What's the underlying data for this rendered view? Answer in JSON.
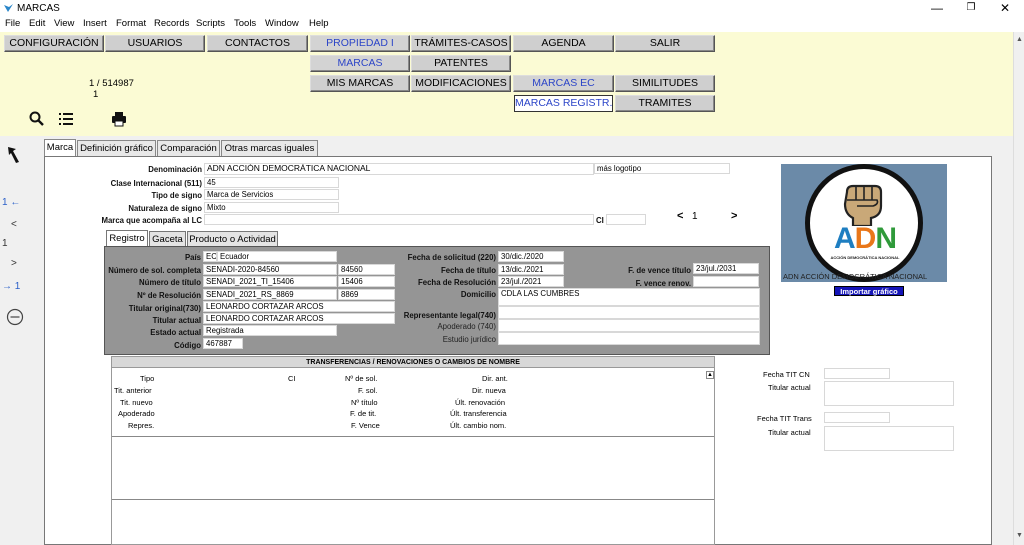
{
  "window": {
    "title": "MARCAS",
    "min": "—",
    "max": "❐",
    "close": "✕"
  },
  "menu": [
    "File",
    "Edit",
    "View",
    "Insert",
    "Format",
    "Records",
    "Scripts",
    "Tools",
    "Window",
    "Help"
  ],
  "nav": {
    "row1": [
      "CONFIGURACIÓN",
      "USUARIOS",
      "CONTACTOS",
      "PROPIEDAD I",
      "TRÁMITES-CASOS",
      "AGENDA",
      "SALIR"
    ],
    "row2": [
      "MARCAS",
      "PATENTES"
    ],
    "row3": [
      "MIS MARCAS",
      "MODIFICACIONES",
      "MARCAS EC",
      "SIMILITUDES"
    ],
    "row4": [
      "MARCAS REGISTR.",
      "TRAMITES"
    ]
  },
  "records": {
    "position": "1 / 514987",
    "found": "1"
  },
  "icons": {
    "search": "search-icon",
    "list": "list-icon",
    "print": "print-icon",
    "back": "back-arrow-icon",
    "remove": "minus-circle-icon"
  },
  "left_panel": {
    "prev_link": "1 ←",
    "prev": "<",
    "page": "1",
    "next": ">",
    "next_link": "→ 1"
  },
  "tabs": [
    "Marca",
    "Definición gráfico",
    "Comparación",
    "Otras marcas iguales"
  ],
  "marca": {
    "denominacion_label": "Denominación",
    "denominacion": "ADN ACCIÓN DEMOCRÁTICA NACIONAL",
    "extra": "más logotipo",
    "clase_label": "Clase Internacional (511)",
    "clase": "45",
    "tipo_label": "Tipo de signo",
    "tipo": "Marca de Servicios",
    "naturaleza_label": "Naturaleza de signo",
    "naturaleza": "Mixto",
    "acompana_label": "Marca que acompaña al LC",
    "ci_label": "CI",
    "pager_prev": "<",
    "pager_page": "1",
    "pager_next": ">"
  },
  "subtabs": [
    "Registro",
    "Gaceta",
    "Producto o Actividad"
  ],
  "registro": {
    "pais_label": "País",
    "pais_code": "EC",
    "pais": "Ecuador",
    "numsol_label": "Número de sol. completa",
    "numsol": "SENADI-2020-84560",
    "numsol_short": "84560",
    "numtit_label": "Número de título",
    "numtit": "SENADI_2021_TI_15406",
    "numtit_short": "15406",
    "numres_label": "Nº de Resolución",
    "numres": "SENADI_2021_RS_8869",
    "numres_short": "8869",
    "titorig_label": "Titular original(730)",
    "titorig": "LEONARDO CORTAZAR ARCOS",
    "titact_label": "Titular actual",
    "titact": "LEONARDO CORTAZAR ARCOS",
    "estado_label": "Estado actual",
    "estado": "Registrada",
    "codigo_label": "Código",
    "codigo": "467887",
    "fsol_label": "Fecha de solicitud (220)",
    "fsol": "30/dic./2020",
    "ftit_label": "Fecha de título",
    "ftit": "13/dic./2021",
    "fres_label": "Fecha de Resolución",
    "fres": "23/jul./2021",
    "dom_label": "Domicilio",
    "dom": "CDLA LAS CUMBRES",
    "replegal_label": "Representante legal(740)",
    "apod_label": "Apoderado (740)",
    "estudio_label": "Estudio jurídico",
    "fvence_label": "F. de vence título",
    "fvence": "23/jul./2031",
    "fvrenov_label": "F. vence renov."
  },
  "logo": {
    "text": "ADN",
    "subtext": "ACCIÓN DEMOCRÁTICA NACIONAL",
    "caption": "ADN ACCIÓN DEMOCRÁTICA NACIONAL",
    "import_btn": "Importar gráfico",
    "colors": {
      "a": "#1e7ec1",
      "d": "#e9771a",
      "n": "#2f9a3a",
      "ring": "#3a9a3a"
    }
  },
  "trans": {
    "header": "TRANSFERENCIAS / RENOVACIONES O CAMBIOS DE NOMBRE",
    "col1": [
      "Tipo",
      "Tit. anterior",
      "Tit. nuevo",
      "Apoderado",
      "Repres."
    ],
    "ci": "CI",
    "col2": [
      "Nº de sol.",
      "F. sol.",
      "Nº título",
      "F. de tit.",
      "F. Vence"
    ],
    "col3": [
      "Dir. ant.",
      "Dir. nueva",
      "Últ. renovación",
      "Últ. transferencia",
      "Últ. cambio nom."
    ]
  },
  "right": {
    "fecha_cn": "Fecha TIT  CN",
    "titular1": "Titular actual",
    "fecha_trans": "Fecha TIT Trans",
    "titular2": "Titular actual"
  }
}
